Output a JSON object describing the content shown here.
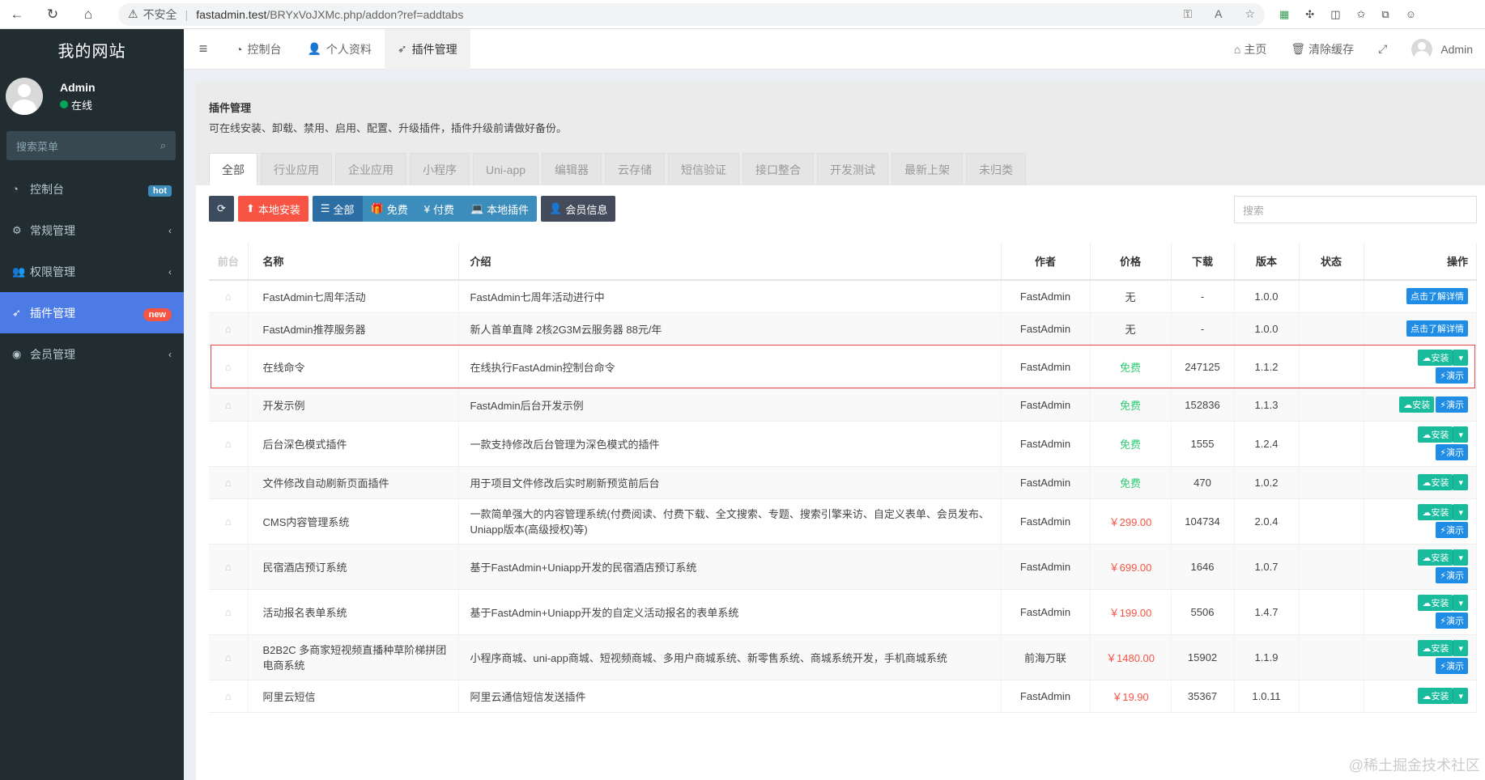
{
  "browser": {
    "security_label": "不安全",
    "url_host": "fastadmin.test",
    "url_path": "/BRYxVoJXMc.php/addon?ref=addtabs"
  },
  "sidebar": {
    "site_name": "我的网站",
    "user_name": "Admin",
    "user_status": "在线",
    "search_placeholder": "搜索菜单",
    "items": [
      {
        "label": "控制台",
        "badge": "hot",
        "icon": "dashboard-icon"
      },
      {
        "label": "常规管理",
        "icon": "cogs-icon"
      },
      {
        "label": "权限管理",
        "icon": "group-icon"
      },
      {
        "label": "插件管理",
        "badge": "new",
        "icon": "rocket-icon"
      },
      {
        "label": "会员管理",
        "icon": "user-circle-icon"
      }
    ]
  },
  "topbar": {
    "tabs": [
      "控制台",
      "个人资料",
      "插件管理"
    ],
    "home": "主页",
    "clear_cache": "清除缓存",
    "admin": "Admin"
  },
  "panel": {
    "title": "插件管理",
    "desc": "可在线安装、卸载、禁用、启用、配置、升级插件，插件升级前请做好备份。",
    "categories": [
      "全部",
      "行业应用",
      "企业应用",
      "小程序",
      "Uni-app",
      "编辑器",
      "云存储",
      "短信验证",
      "接口整合",
      "开发测试",
      "最新上架",
      "未归类"
    ],
    "buttons": {
      "local_install": "本地安装",
      "all": "全部",
      "free": "免费",
      "paid": "付费",
      "local_plugins": "本地插件",
      "member_info": "会员信息"
    },
    "search_placeholder": "搜索"
  },
  "table": {
    "headers": [
      "前台",
      "名称",
      "介绍",
      "作者",
      "价格",
      "下载",
      "版本",
      "状态",
      "操作"
    ],
    "rows": [
      {
        "name": "FastAdmin七周年活动",
        "intro": "FastAdmin七周年活动进行中",
        "author": "FastAdmin",
        "price": "无",
        "downloads": "-",
        "version": "1.0.0",
        "op": "info"
      },
      {
        "name": "FastAdmin推荐服务器",
        "intro": "新人首单直降 2核2G3M云服务器 88元/年",
        "author": "FastAdmin",
        "price": "无",
        "downloads": "-",
        "version": "1.0.0",
        "op": "info"
      },
      {
        "name": "在线命令",
        "intro": "在线执行FastAdmin控制台命令",
        "author": "FastAdmin",
        "price": "免费",
        "downloads": "247125",
        "version": "1.1.2",
        "op": "install-demo"
      },
      {
        "name": "开发示例",
        "intro": "FastAdmin后台开发示例",
        "author": "FastAdmin",
        "price": "免费",
        "downloads": "152836",
        "version": "1.1.3",
        "op": "install-inline"
      },
      {
        "name": "后台深色模式插件",
        "intro": "一款支持修改后台管理为深色模式的插件",
        "author": "FastAdmin",
        "price": "免费",
        "downloads": "1555",
        "version": "1.2.4",
        "op": "install-demo"
      },
      {
        "name": "文件修改自动刷新页面插件",
        "intro": "用于项目文件修改后实时刷新预览前后台",
        "author": "FastAdmin",
        "price": "免费",
        "downloads": "470",
        "version": "1.0.2",
        "op": "install"
      },
      {
        "name": "CMS内容管理系统",
        "intro": "一款简单强大的内容管理系统(付费阅读、付费下载、全文搜索、专题、搜索引擎来访、自定义表单、会员发布、Uniapp版本(高级授权)等)",
        "author": "FastAdmin",
        "price": "￥299.00",
        "downloads": "104734",
        "version": "2.0.4",
        "op": "install-demo"
      },
      {
        "name": "民宿酒店预订系统",
        "intro": "基于FastAdmin+Uniapp开发的民宿酒店预订系统",
        "author": "FastAdmin",
        "price": "￥699.00",
        "downloads": "1646",
        "version": "1.0.7",
        "op": "install-demo"
      },
      {
        "name": "活动报名表单系统",
        "intro": "基于FastAdmin+Uniapp开发的自定义活动报名的表单系统",
        "author": "FastAdmin",
        "price": "￥199.00",
        "downloads": "5506",
        "version": "1.4.7",
        "op": "install-demo"
      },
      {
        "name": "B2B2C 多商家短视频直播种草阶梯拼团电商系统",
        "intro": "小程序商城、uni-app商城、短视频商城、多用户商城系统、新零售系统、商城系统开发，手机商城系统",
        "author": "前海万联",
        "price": "￥1480.00",
        "downloads": "15902",
        "version": "1.1.9",
        "op": "install-demo"
      },
      {
        "name": "阿里云短信",
        "intro": "阿里云通信短信发送插件",
        "author": "FastAdmin",
        "price": "￥19.90",
        "downloads": "35367",
        "version": "1.0.11",
        "op": "install"
      }
    ],
    "op_labels": {
      "info": "点击了解详情",
      "install": "安装",
      "demo": "演示"
    }
  },
  "watermark": "@稀土掘金技术社区"
}
